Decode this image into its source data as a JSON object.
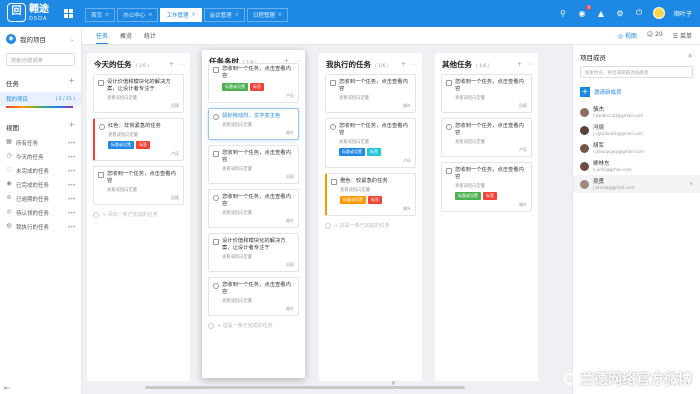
{
  "app": {
    "logo_char": "回",
    "brand": "翱途",
    "brand_sub": "OSOA"
  },
  "top_tabs": [
    {
      "label": "首页",
      "active": false
    },
    {
      "label": "办公中心",
      "active": false
    },
    {
      "label": "工作管理",
      "active": true
    },
    {
      "label": "会议管理",
      "active": false
    },
    {
      "label": "日程管理",
      "active": false
    }
  ],
  "top_right": {
    "badge": "9",
    "user": "顺叶子"
  },
  "sidebar": {
    "project_title": "我的项目",
    "search_placeholder": "搜索/创建或筛",
    "task_section": "任务",
    "my_project": {
      "label": "我的项目",
      "count": "( 2 / 15 )"
    },
    "view_section": "视图",
    "views": [
      "所有任务",
      "今天的任务",
      "未完成的任务",
      "已完成的任务",
      "已逾期的任务",
      "待认领的任务",
      "我执行的任务"
    ]
  },
  "subbar": {
    "tabs": [
      "任务",
      "概览",
      "统计"
    ],
    "view_label": "视图",
    "members_count": "20",
    "menu_label": "菜单"
  },
  "columns": [
    {
      "title": "今天的任务",
      "count": "( 1/6 )",
      "cards": [
        {
          "title": "设计价值和模块化的解决方案，让设计者专注于",
          "sub": "查看或指向定量",
          "footer": "回顾"
        },
        {
          "title": "红色：非常紧急的任务",
          "sub": "查看或指向定量",
          "tags": [
            {
              "text": "标题或设置",
              "color": "#1e88e5"
            },
            {
              "text": "标签",
              "color": "#f44336"
            }
          ],
          "footer": "卢珏",
          "accent": "red"
        },
        {
          "title": "您收到一个任务，点击查看内容",
          "sub": "查看或指向定量",
          "footer": "回顾"
        }
      ],
      "add": "+ 添加一条已完成的任务"
    },
    {
      "title": "任务多时",
      "count": "( 1/9 )",
      "cards": [
        {
          "title": "您收到一个任务，点击查看内容",
          "sub": "",
          "tags": [
            {
              "text": "标题或设置",
              "color": "#4caf50"
            },
            {
              "text": "标签",
              "color": "#f44336"
            }
          ],
          "footer": "卢珏"
        },
        {
          "title": "鼠标移动时，文字变主色",
          "sub": "查看或指向定量",
          "footer": "顺叶",
          "highlight": true
        },
        {
          "title": "您收到一个任务，点击查看内容",
          "sub": "查看或指向定量",
          "footer": "回顾"
        },
        {
          "title": "您收到一个任务，点击查看内容",
          "sub": "查看或指向定量",
          "footer": "顺叶"
        },
        {
          "title": "设计价值和模块化的解决方案，让设计者专注于",
          "sub": "查看或指向定量",
          "footer": "回顾"
        },
        {
          "title": "您收到一个任务，点击查看内容",
          "sub": "查看或指向定量",
          "footer": "顺叶"
        }
      ],
      "add": "+ 这是一条已完成的任务"
    },
    {
      "title": "我执行的任务",
      "count": "( 1/6 )",
      "cards": [
        {
          "title": "您收到一个任务，点击查看内容",
          "sub": "查看或指向定量",
          "footer": "顺叶"
        },
        {
          "title": "您收到一个任务，点击查看内容",
          "sub": "查看或指向定量",
          "tags": [
            {
              "text": "标题或设置",
              "color": "#1e88e5"
            },
            {
              "text": "标签",
              "color": "#26c6da"
            }
          ],
          "footer": "卢珏"
        },
        {
          "title": "橙色：较紧急的任务",
          "sub": "查看或指向定量",
          "tags": [
            {
              "text": "标题或设置",
              "color": "#ff9800"
            },
            {
              "text": "标签",
              "color": "#f44336"
            }
          ],
          "footer": "顺叶",
          "accent": "orange"
        }
      ],
      "add": "+ 这是一条已完成的任务"
    },
    {
      "title": "其他任务",
      "count": "( 1/6 )",
      "cards": [
        {
          "title": "您收到一个任务，点击查看内容",
          "sub": "查看或指向定量",
          "footer": "回顾"
        },
        {
          "title": "您收到一个任务，点击查看内容",
          "sub": "查看或指向定量",
          "footer": "卢珏"
        },
        {
          "title": "您收到一个任务，点击查看内容",
          "sub": "查看或指向定量",
          "tags": [
            {
              "text": "标题或设置",
              "color": "#4caf50"
            },
            {
              "text": "标签",
              "color": "#f44336"
            }
          ],
          "footer": "顺叶"
        }
      ]
    }
  ],
  "panel": {
    "title": "项目成员",
    "search_placeholder": "搜索姓名、拼音或邮箱添加邀请",
    "invite": "邀请新成员",
    "members": [
      {
        "name": "骆杰",
        "email": "f.wjobtccud@gmail.com",
        "color": "#8d6e63"
      },
      {
        "name": "冯焜",
        "email": "j.cjjtuhkukk@gmail.com",
        "color": "#5d4037"
      },
      {
        "name": "胡军",
        "email": "r.jckkuyuyqi@gmail.com",
        "color": "#795548"
      },
      {
        "name": "柳林东",
        "email": "k.jima@gmail.com",
        "color": "#6d4c41"
      },
      {
        "name": "吴勇",
        "email": "j.btnvw@gmail.com",
        "color": "#a1887f"
      }
    ]
  },
  "watermark": "兰德网络官方微博"
}
